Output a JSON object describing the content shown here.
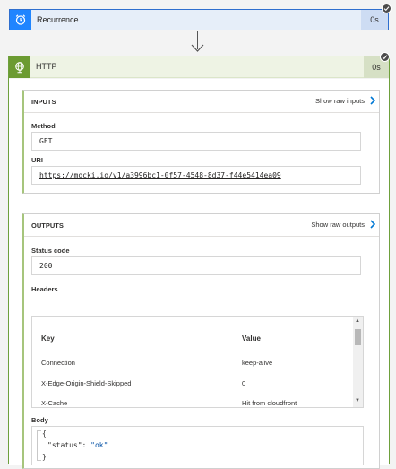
{
  "recurrence": {
    "title": "Recurrence",
    "duration": "0s"
  },
  "http": {
    "title": "HTTP",
    "duration": "0s"
  },
  "inputs": {
    "title": "INPUTS",
    "show_raw": "Show raw inputs",
    "method_label": "Method",
    "method_value": "GET",
    "uri_label": "URI",
    "uri_value": "https://mocki.io/v1/a3996bc1-0f57-4548-8d37-f44e5414ea09"
  },
  "outputs": {
    "title": "OUTPUTS",
    "show_raw": "Show raw outputs",
    "status_label": "Status code",
    "status_value": "200",
    "headers_label": "Headers",
    "headers_table": {
      "col_key": "Key",
      "col_value": "Value",
      "rows": [
        {
          "key": "Connection",
          "value": "keep-alive"
        },
        {
          "key": "X-Edge-Origin-Shield-Skipped",
          "value": "0"
        },
        {
          "key": "X-Cache",
          "value": "Hit from cloudfront"
        }
      ]
    },
    "body_label": "Body",
    "body_json": {
      "open": "{",
      "key": "\"status\"",
      "colon": ": ",
      "value": "\"ok\"",
      "close": "}"
    }
  },
  "colors": {
    "recurrence_accent": "#1f85ff",
    "http_accent": "#6c9b32",
    "http_border": "#6ea03c",
    "link_chevron": "#0078d4"
  }
}
